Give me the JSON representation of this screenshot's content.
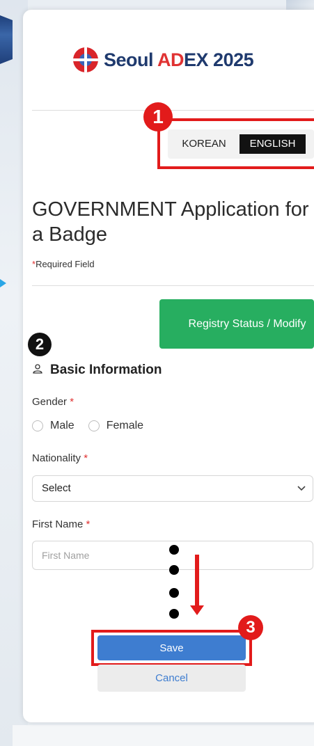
{
  "header": {
    "logo_text_1": "Seoul ",
    "logo_text_ad": "AD",
    "logo_text_ex": "EX",
    "logo_text_year": " 2025"
  },
  "language": {
    "korean_label": "KOREAN",
    "english_label": "ENGLISH",
    "selected": "ENGLISH"
  },
  "annotations": {
    "step1": "1",
    "step2": "2",
    "step3": "3"
  },
  "page": {
    "title": "GOVERNMENT Application for a Badge",
    "required_star": "*",
    "required_note": "Required Field"
  },
  "actions": {
    "registry_status": "Registry Status / Modify"
  },
  "section": {
    "title": "Basic Information",
    "icon": "user-icon"
  },
  "form": {
    "gender": {
      "label": "Gender",
      "required": "*",
      "options": [
        "Male",
        "Female"
      ]
    },
    "nationality": {
      "label": "Nationality",
      "required": "*",
      "value": "Select"
    },
    "first_name": {
      "label": "First Name",
      "required": "*",
      "placeholder": "First Name"
    }
  },
  "buttons": {
    "save": "Save",
    "cancel": "Cancel"
  },
  "colors": {
    "accent_red": "#e21b1b",
    "registry_green": "#27ae60",
    "save_blue": "#3e7dd0"
  }
}
